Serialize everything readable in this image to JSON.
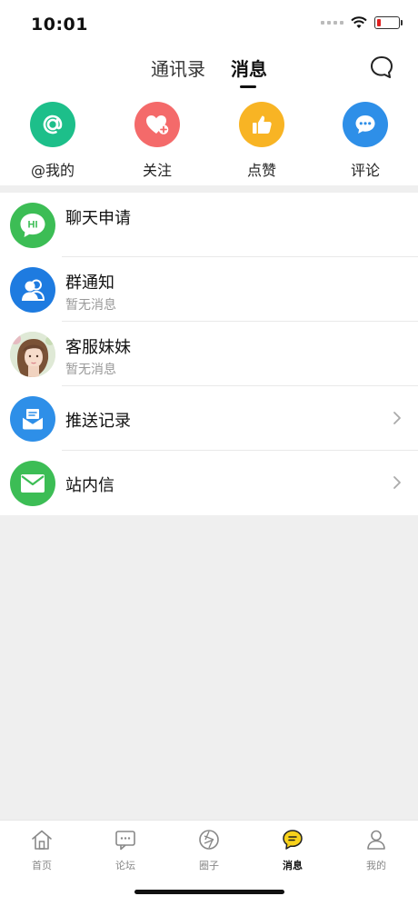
{
  "status": {
    "time": "10:01"
  },
  "header": {
    "tabs": [
      {
        "label": "通讯录"
      },
      {
        "label": "消息"
      }
    ],
    "active_tab": "消息"
  },
  "quick_actions": [
    {
      "label": "@我的",
      "icon": "at-icon",
      "color": "#1dbf8a"
    },
    {
      "label": "关注",
      "icon": "heart-plus-icon",
      "color": "#f46a6a"
    },
    {
      "label": "点赞",
      "icon": "thumbs-up-icon",
      "color": "#f8b424"
    },
    {
      "label": "评论",
      "icon": "comment-icon",
      "color": "#2e8fe8"
    }
  ],
  "messages": [
    {
      "title": "聊天申请",
      "subtitle": "",
      "icon": "hi-bubble-icon",
      "color": "#3cbd55",
      "icon_text": "HI"
    },
    {
      "title": "群通知",
      "subtitle": "暂无消息",
      "icon": "group-icon",
      "color": "#1e7be0"
    },
    {
      "title": "客服妹妹",
      "subtitle": "暂无消息",
      "icon": "avatar-photo",
      "color": "#d8e8d0"
    },
    {
      "title": "推送记录",
      "subtitle": "",
      "icon": "inbox-icon",
      "color": "#2e8fe8",
      "chevron": true
    },
    {
      "title": "站内信",
      "subtitle": "",
      "icon": "mail-icon",
      "color": "#3cbd55",
      "chevron": true
    }
  ],
  "tabbar": {
    "items": [
      {
        "label": "首页",
        "icon": "home-icon"
      },
      {
        "label": "论坛",
        "icon": "forum-icon"
      },
      {
        "label": "圈子",
        "icon": "circle-icon"
      },
      {
        "label": "消息",
        "icon": "message-icon",
        "active": true
      },
      {
        "label": "我的",
        "icon": "profile-icon"
      }
    ]
  },
  "colors": {
    "accent_yellow": "#f8d21b",
    "battery_low": "#e02020"
  }
}
